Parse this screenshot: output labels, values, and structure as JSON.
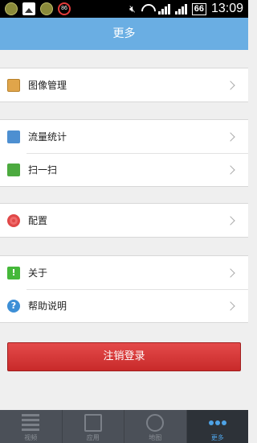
{
  "status_bar": {
    "badge_number": "86",
    "battery": "66",
    "time": "13:09"
  },
  "header": {
    "title": "更多"
  },
  "groups": [
    {
      "items": [
        {
          "label": "图像管理",
          "icon": "image-manage-icon"
        }
      ]
    },
    {
      "items": [
        {
          "label": "流量统计",
          "icon": "stats-icon"
        },
        {
          "label": "扫一扫",
          "icon": "scan-icon"
        }
      ]
    },
    {
      "items": [
        {
          "label": "配置",
          "icon": "gear-icon"
        }
      ]
    },
    {
      "items": [
        {
          "label": "关于",
          "icon": "about-icon"
        },
        {
          "label": "帮助说明",
          "icon": "help-icon"
        }
      ]
    }
  ],
  "logout": {
    "label": "注销登录"
  },
  "tabs": [
    {
      "label": "视频",
      "icon": "video-list-icon"
    },
    {
      "label": "应用",
      "icon": "app-icon"
    },
    {
      "label": "地图",
      "icon": "map-globe-icon"
    },
    {
      "label": "更多",
      "icon": "more-dots-icon",
      "active": true
    }
  ],
  "colors": {
    "header": "#6aaee3",
    "logout": "#d63a3a",
    "tab_active": "#4ea3e6"
  }
}
